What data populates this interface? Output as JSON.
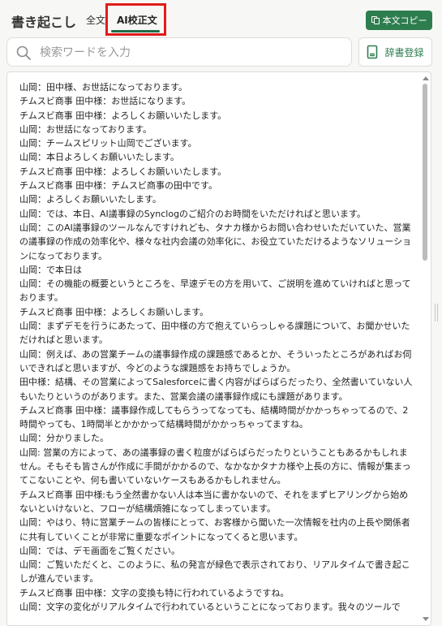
{
  "header": {
    "title": "書き起こし",
    "tabs": [
      {
        "label": "全文",
        "active": false
      },
      {
        "label": "AI校正文",
        "active": true
      }
    ],
    "copy_button": {
      "label": "本文コピー",
      "icon": "copy-icon"
    }
  },
  "search": {
    "placeholder": "検索ワードを入力",
    "value": "",
    "icon": "search-icon"
  },
  "dictionary_button": {
    "label": "辞書登録",
    "icon": "book-icon"
  },
  "colors": {
    "accent": "#2e7d4f",
    "highlight_border": "#e11b1b"
  },
  "transcript": [
    "山岡：田中様、お世話になっております。",
    "チムスビ商事 田中様：お世話になります。",
    "チムスビ商事 田中様：よろしくお願いいたします。",
    "山岡：お世話になっております。",
    "山岡：チームスピリット山岡でございます。",
    "山岡：本日よろしくお願いいたします。",
    "チムスビ商事 田中様：よろしくお願いいたします。",
    "チムスビ商事 田中様：チムスビ商事の田中です。",
    "山岡：よろしくお願いいたします。",
    "山岡：では、本日、AI議事録のSynclogのご紹介のお時間をいただければと思います。",
    "山岡：このAI議事録のツールなんですけれども、タナカ様からお問い合わせいただいていた、営業の議事録の作成の効率化や、様々な社内会議の効率化に、お役立ていただけるようなソリューションになっております。",
    "山岡：で本日は",
    "山岡：その機能の概要というところを、早速デモの方を用いて、ご説明を進めていければと思っております。",
    "チムスビ商事 田中様：よろしくお願いします。",
    "山岡：まずデモを行うにあたって、田中様の方で抱えていらっしゃる課題について、お聞かせいただければと思います。",
    "山岡：例えば、あの営業チームの議事録作成の課題感であるとか、そういったところがあればお伺いできればと思いますが、今どのような課題感をお持ちでしょうか。",
    "田中様：結構、その営業によってSalesforceに書く内容がばらばらだったり、全然書いていない人もいたりというのがあります。また、営業会議の議事録作成にも課題があります。",
    "チムスビ商事 田中様：議事録作成してもらうってなっても、結構時間がかかっちゃってるので、2時間やっても、1時間半とかかかって結構時間がかかっちゃってますね。",
    "山岡：分かりました。",
    "山岡: 営業の方によって、あの議事録の書く粒度がばらばらだったりということもあるかもしれません。そもそも皆さんが作成に手間がかかるので、なかなかタナカ様や上長の方に、情報が集まってこないことや、何も書いていないケースもあるかもしれません。",
    "チムスビ商事 田中様:もう全然書かない人は本当に書かないので、それをまずヒアリングから始めないといけないと、フローが結構煩雑になってしまっています。",
    "山岡：やはり、特に営業チームの皆様にとって、お客様から聞いた一次情報を社内の上長や関係者に共有していくことが非常に重要なポイントになってくると思います。",
    "山岡：では、デモ画面をご覧ください。",
    "山岡：ご覧いただくと、このように、私の発言が緑色で表示されており、リアルタイムで書き起こしが進んでいます。",
    "チムスビ商事 田中様：文字の変換も特に行われているようですね。",
    "山岡：文字の変化がリアルタイムで行われているということになっております。我々のツールで"
  ]
}
